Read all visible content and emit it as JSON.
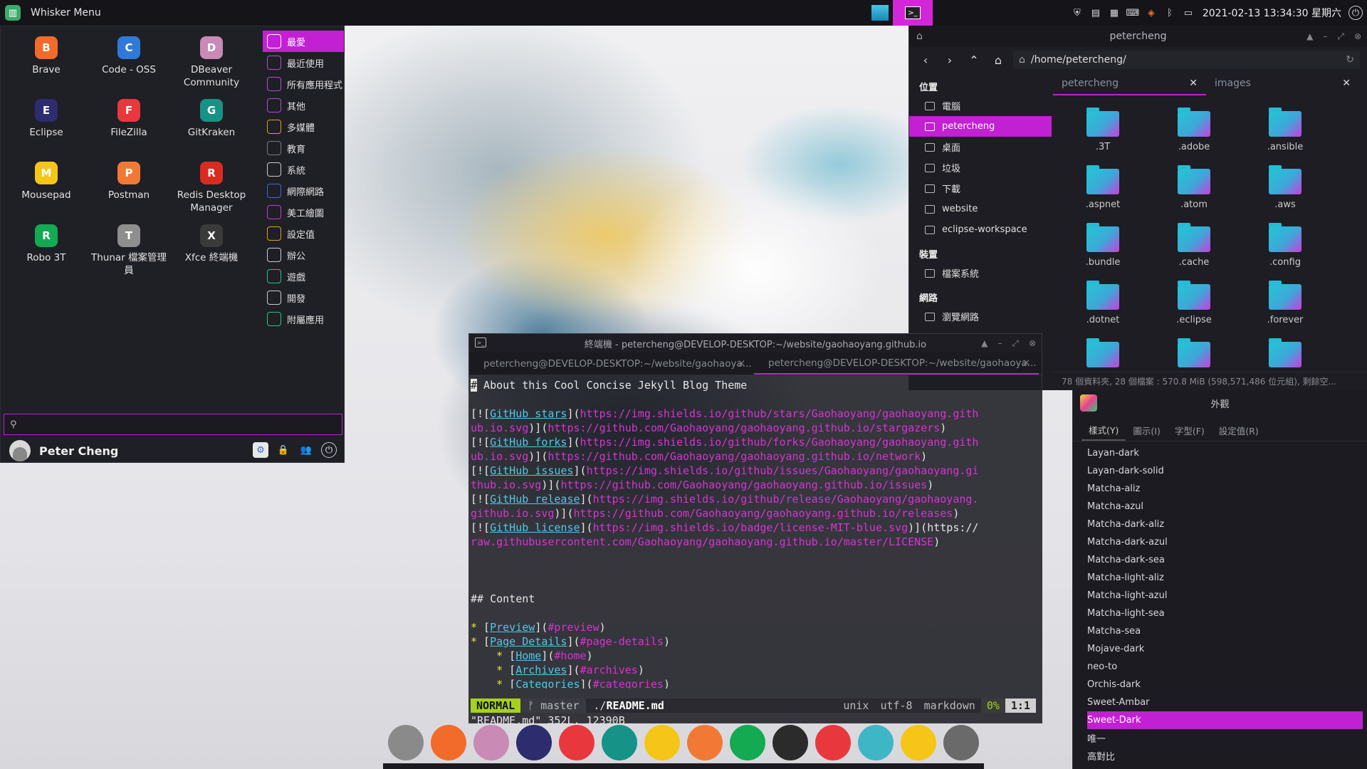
{
  "top_panel": {
    "menu_title": "Whisker Menu",
    "clock": "2021-02-13 13:34:30 星期六"
  },
  "whisker": {
    "favorites": [
      {
        "label": "Brave",
        "icon": "brave-icon",
        "color": "#f26b2a"
      },
      {
        "label": "Code - OSS",
        "icon": "code-oss-icon",
        "color": "#2f7ad8"
      },
      {
        "label": "DBeaver Community",
        "icon": "dbeaver-icon",
        "color": "#c98ab5"
      },
      {
        "label": "Eclipse",
        "icon": "eclipse-icon",
        "color": "#2c2c6e"
      },
      {
        "label": "FileZilla",
        "icon": "filezilla-icon",
        "color": "#e8383d"
      },
      {
        "label": "GitKraken",
        "icon": "gitkraken-icon",
        "color": "#179287"
      },
      {
        "label": "Mousepad",
        "icon": "mousepad-icon",
        "color": "#f5c518"
      },
      {
        "label": "Postman",
        "icon": "postman-icon",
        "color": "#f27935"
      },
      {
        "label": "Redis Desktop Manager",
        "icon": "redis-icon",
        "color": "#d82c20"
      },
      {
        "label": "Robo 3T",
        "icon": "robo3t-icon",
        "color": "#13aa52"
      },
      {
        "label": "Thunar 檔案管理員",
        "icon": "thunar-icon",
        "color": "#8e8e8e"
      },
      {
        "label": "Xfce 終端機",
        "icon": "terminal-icon",
        "color": "#3a3a3a"
      }
    ],
    "categories": [
      {
        "label": "最愛",
        "icon": "star-icon",
        "color": "#ffffff"
      },
      {
        "label": "最近使用",
        "icon": "clock-icon",
        "color": "#b04fd0"
      },
      {
        "label": "所有應用程式",
        "icon": "apps-icon",
        "color": "#b04fd0"
      },
      {
        "label": "其他",
        "icon": "other-icon",
        "color": "#b04fd0"
      },
      {
        "label": "多媒體",
        "icon": "multimedia-icon",
        "color": "#e0a020"
      },
      {
        "label": "教育",
        "icon": "education-icon",
        "color": "#7a7a7a"
      },
      {
        "label": "系統",
        "icon": "system-icon",
        "color": "#cccccc"
      },
      {
        "label": "網際網路",
        "icon": "internet-icon",
        "color": "#3a6fd8"
      },
      {
        "label": "美工繪圖",
        "icon": "graphics-icon",
        "color": "#c23ad8"
      },
      {
        "label": "設定值",
        "icon": "settings-icon",
        "color": "#e0a020"
      },
      {
        "label": "辦公",
        "icon": "office-icon",
        "color": "#cccccc"
      },
      {
        "label": "遊戲",
        "icon": "games-icon",
        "color": "#2ec27e"
      },
      {
        "label": "開發",
        "icon": "development-icon",
        "color": "#cccccc"
      },
      {
        "label": "附屬應用",
        "icon": "accessories-icon",
        "color": "#2ec27e"
      }
    ],
    "search_value": "",
    "user_name": "Peter Cheng"
  },
  "file_manager": {
    "title": "petercheng",
    "path": "/home/petercheng/",
    "sidebar": {
      "places_header": "位置",
      "places": [
        "電腦",
        "petercheng",
        "桌面",
        "垃圾",
        "下載",
        "website",
        "eclipse-workspace"
      ],
      "devices_header": "裝置",
      "devices": [
        "檔案系統"
      ],
      "network_header": "網路",
      "network": [
        "瀏覽網路"
      ]
    },
    "tabs": [
      "petercheng",
      "images"
    ],
    "folders": [
      ".3T",
      ".adobe",
      ".ansible",
      ".aspnet",
      ".atom",
      ".aws",
      ".bundle",
      ".cache",
      ".config",
      ".dotnet",
      ".eclipse",
      ".forever",
      "",
      "",
      ""
    ],
    "status": "78 個資料夾, 28 個檔案 : 570.8 MiB (598,571,486 位元組), 剩餘空..."
  },
  "appearance": {
    "title": "外觀",
    "tabs": [
      "樣式(Y)",
      "圖示(I)",
      "字型(F)",
      "設定值(R)"
    ],
    "themes": [
      "Layan-dark",
      "Layan-dark-solid",
      "Matcha-aliz",
      "Matcha-azul",
      "Matcha-dark-aliz",
      "Matcha-dark-azul",
      "Matcha-dark-sea",
      "Matcha-light-aliz",
      "Matcha-light-azul",
      "Matcha-light-sea",
      "Matcha-sea",
      "Mojave-dark",
      "neo-to",
      "Orchis-dark",
      "Sweet-Ambar",
      "Sweet-Dark",
      "唯一",
      "高對比"
    ],
    "selected_theme": "Sweet-Dark"
  },
  "terminal": {
    "title": "終端機 - petercheng@DEVELOP-DESKTOP:~/website/gaohaoyang.github.io",
    "tabs": [
      "petercheng@DEVELOP-DESKTOP:~/website/gaohaoya...",
      "petercheng@DEVELOP-DESKTOP:~/website/gaohaoya..."
    ],
    "lines": [
      "# About this Cool Concise Jekyll Blog Theme",
      "",
      "[![GitHub stars](https://img.shields.io/github/stars/Gaohaoyang/gaohaoyang.gith",
      "ub.io.svg)](https://github.com/Gaohaoyang/gaohaoyang.github.io/stargazers)",
      "[![GitHub forks](https://img.shields.io/github/forks/Gaohaoyang/gaohaoyang.gith",
      "ub.io.svg)](https://github.com/Gaohaoyang/gaohaoyang.github.io/network)",
      "[![GitHub issues](https://img.shields.io/github/issues/Gaohaoyang/gaohaoyang.gi",
      "thub.io.svg)](https://github.com/Gaohaoyang/gaohaoyang.github.io/issues)",
      "[![GitHub release](https://img.shields.io/github/release/Gaohaoyang/gaohaoyang.",
      "github.io.svg)](https://github.com/Gaohaoyang/gaohaoyang.github.io/releases)",
      "[![GitHub license](https://img.shields.io/badge/license-MIT-blue.svg)](https://",
      "raw.githubusercontent.com/Gaohaoyang/gaohaoyang.github.io/master/LICENSE)",
      "",
      "",
      "",
      "## Content",
      "",
      "* [Preview](#preview)",
      "* [Page Details](#page-details)",
      "    * [Home](#home)",
      "    * [Archives](#archives)",
      "    * [Categories](#categories)"
    ],
    "status": {
      "mode": "NORMAL",
      "branch": "master",
      "file_prefix": "./",
      "file": "README.md",
      "format": "unix",
      "encoding": "utf-8",
      "filetype": "markdown",
      "percent": "0%",
      "position": "1:1"
    },
    "cmdline": "\"README.md\" 352L, 12390B"
  },
  "dock": [
    {
      "icon": "thunar-icon",
      "color": "#8a8a8a"
    },
    {
      "icon": "brave-icon",
      "color": "#f26b2a"
    },
    {
      "icon": "dbeaver-icon",
      "color": "#c98ab5"
    },
    {
      "icon": "eclipse-icon",
      "color": "#2c2c6e"
    },
    {
      "icon": "filezilla-icon",
      "color": "#e8383d"
    },
    {
      "icon": "gitkraken-icon",
      "color": "#179287"
    },
    {
      "icon": "mousepad-icon",
      "color": "#f5c518"
    },
    {
      "icon": "postman-icon",
      "color": "#f27935"
    },
    {
      "icon": "robo3t-icon",
      "color": "#13aa52"
    },
    {
      "icon": "terminal-icon",
      "color": "#2b2b2b"
    },
    {
      "icon": "trash-icon",
      "color": "#e8383d"
    },
    {
      "icon": "atom-icon",
      "color": "#3fb6c6"
    },
    {
      "icon": "paint-icon",
      "color": "#f5c518"
    },
    {
      "icon": "inkscape-icon",
      "color": "#6a6a6a"
    }
  ]
}
